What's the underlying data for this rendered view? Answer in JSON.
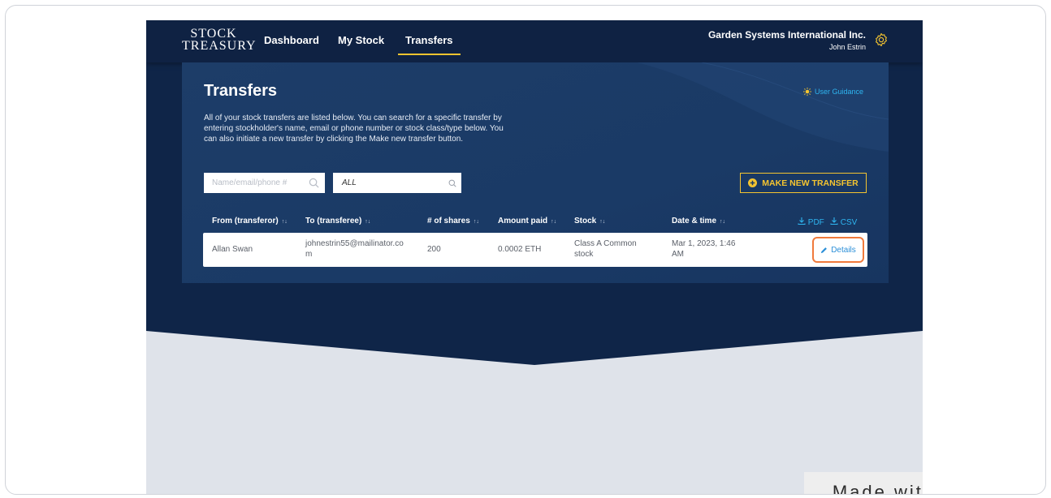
{
  "brand": {
    "logo_line1": "STOCK",
    "logo_line2": "TREASURY"
  },
  "nav": {
    "items": [
      {
        "label": "Dashboard"
      },
      {
        "label": "My Stock"
      },
      {
        "label": "Transfers"
      }
    ],
    "active": "Transfers"
  },
  "account": {
    "company": "Garden Systems International Inc.",
    "user": "John Estrin",
    "settings_icon": "gear-icon"
  },
  "page": {
    "title": "Transfers",
    "guidance_label": "User Guidance",
    "description": "All of your stock transfers are listed below. You can search for a specific transfer by entering stockholder's name, email or phone number or stock class/type below. You can also initiate a new transfer by clicking the Make new transfer button."
  },
  "filters": {
    "search_placeholder": "Name/email/phone #",
    "search_value": "",
    "class_value": "ALL"
  },
  "actions": {
    "make_transfer_label": "MAKE NEW TRANSFER",
    "pdf_label": "PDF",
    "csv_label": "CSV"
  },
  "table": {
    "columns": [
      "From (transferor)",
      "To (transferee)",
      "# of shares",
      "Amount paid",
      "Stock",
      "Date & time"
    ],
    "rows": [
      {
        "from": "Allan Swan",
        "to_line1": "johnestrin55@mailinator.co",
        "to_line2": "m",
        "shares": "200",
        "amount": "0.0002 ETH",
        "stock_line1": "Class A Common",
        "stock_line2": "stock",
        "date_line1": "Mar 1, 2023, 1:46",
        "date_line2": "AM",
        "details_label": "Details"
      }
    ]
  },
  "watermark": "Made with Tango.us",
  "colors": {
    "navy": "#0f2243",
    "panel": "#1a3a66",
    "accent_yellow": "#f4c430",
    "link_blue": "#2eb5f0",
    "highlight": "#f07a3c"
  }
}
